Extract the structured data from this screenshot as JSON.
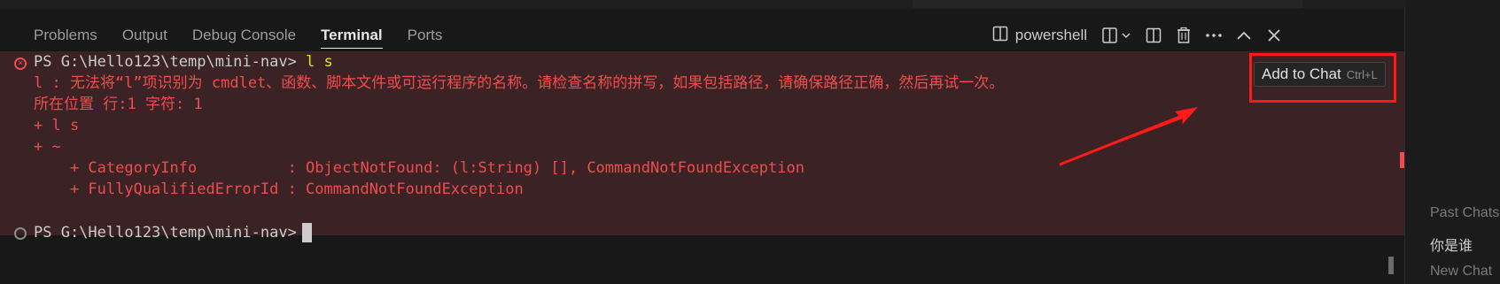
{
  "tabs": [
    {
      "label": "Problems"
    },
    {
      "label": "Output"
    },
    {
      "label": "Debug Console"
    },
    {
      "label": "Terminal"
    },
    {
      "label": "Ports"
    }
  ],
  "shell_label": "powershell",
  "terminal": {
    "prompt1": "PS G:\\Hello123\\temp\\mini-nav>",
    "cmd1": "l s",
    "error_lines": [
      "l : 无法将“l”项识别为 cmdlet、函数、脚本文件或可运行程序的名称。请检查名称的拼写，如果包括路径，请确保路径正确，然后再试一次。",
      "所在位置 行:1 字符: 1",
      "+ l s",
      "+ ~",
      "    + CategoryInfo          : ObjectNotFound: (l:String) [], CommandNotFoundException",
      "    + FullyQualifiedErrorId : CommandNotFoundException"
    ],
    "prompt2": "PS G:\\Hello123\\temp\\mini-nav>"
  },
  "tooltip": {
    "label": "Add to Chat",
    "shortcut": "Ctrl+L"
  },
  "side_panel": {
    "items": [
      {
        "label": "Past Chats"
      },
      {
        "label": "你是谁"
      },
      {
        "label": "New Chat"
      }
    ]
  },
  "colors": {
    "error": "#f14c4c",
    "annotation": "#ff1a1a",
    "prompt": "#cccccc",
    "command": "#e5e510"
  }
}
